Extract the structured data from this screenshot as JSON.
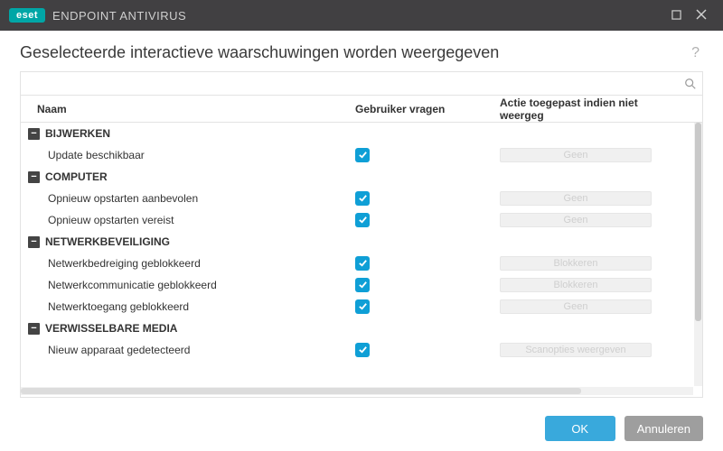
{
  "brand": {
    "badge": "eset",
    "product": "ENDPOINT ANTIVIRUS"
  },
  "header": {
    "title": "Geselecteerde interactieve waarschuwingen worden weergegeven",
    "help": "?"
  },
  "search": {
    "value": "",
    "placeholder": ""
  },
  "columns": {
    "name": "Naam",
    "ask": "Gebruiker vragen",
    "action": "Actie toegepast indien niet weergeg"
  },
  "groups": [
    {
      "label": "BIJWERKEN",
      "items": [
        {
          "name": "Update beschikbaar",
          "ask": true,
          "action": "Geen"
        }
      ]
    },
    {
      "label": "COMPUTER",
      "items": [
        {
          "name": "Opnieuw opstarten aanbevolen",
          "ask": true,
          "action": "Geen"
        },
        {
          "name": "Opnieuw opstarten vereist",
          "ask": true,
          "action": "Geen"
        }
      ]
    },
    {
      "label": "NETWERKBEVEILIGING",
      "items": [
        {
          "name": "Netwerkbedreiging geblokkeerd",
          "ask": true,
          "action": "Blokkeren"
        },
        {
          "name": "Netwerkcommunicatie geblokkeerd",
          "ask": true,
          "action": "Blokkeren"
        },
        {
          "name": "Netwerktoegang geblokkeerd",
          "ask": true,
          "action": "Geen"
        }
      ]
    },
    {
      "label": "VERWISSELBARE MEDIA",
      "items": [
        {
          "name": "Nieuw apparaat gedetecteerd",
          "ask": true,
          "action": "Scanopties weergeven"
        }
      ]
    }
  ],
  "footer": {
    "ok": "OK",
    "cancel": "Annuleren"
  }
}
